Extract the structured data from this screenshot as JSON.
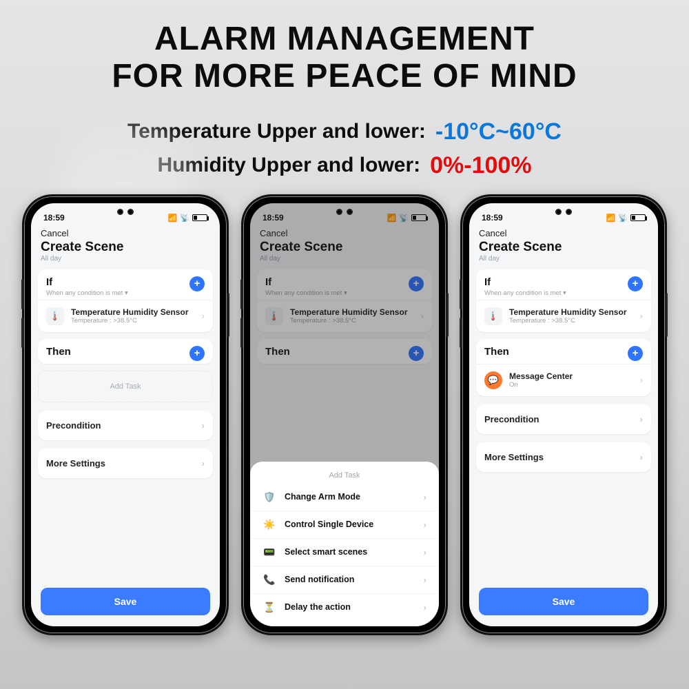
{
  "headline": {
    "line1": "ALARM MANAGEMENT",
    "line2": "FOR MORE PEACE OF MIND"
  },
  "specs": {
    "temp_label": "Temperature Upper and lower:",
    "temp_value": "-10°C~60°C",
    "hum_label": "Humidity Upper and lower:",
    "hum_value": "0%-100%"
  },
  "phone_common": {
    "time": "18:59",
    "cancel": "Cancel",
    "screen_title": "Create Scene",
    "all_day": "All day",
    "if_title": "If",
    "if_sub": "When any condition is met ▾",
    "sensor_name": "Temperature Humidity Sensor",
    "sensor_sub": "Temperature : >38.5°C",
    "then_title": "Then",
    "add_task": "Add Task",
    "precondition": "Precondition",
    "more_settings": "More Settings",
    "save": "Save"
  },
  "phone2_sheet": {
    "title": "Add Task",
    "options": [
      {
        "icon": "🛡️",
        "color": "#6b3ef0",
        "label": "Change Arm Mode"
      },
      {
        "icon": "☀️",
        "color": "#ff9f1a",
        "label": "Control Single Device"
      },
      {
        "icon": "📟",
        "color": "#ff4d4d",
        "label": "Select smart scenes"
      },
      {
        "icon": "📞",
        "color": "#18b56a",
        "label": "Send notification"
      },
      {
        "icon": "⏳",
        "color": "#2f8bff",
        "label": "Delay the action"
      }
    ]
  },
  "phone3_then": {
    "item_title": "Message Center",
    "item_sub": "On"
  }
}
